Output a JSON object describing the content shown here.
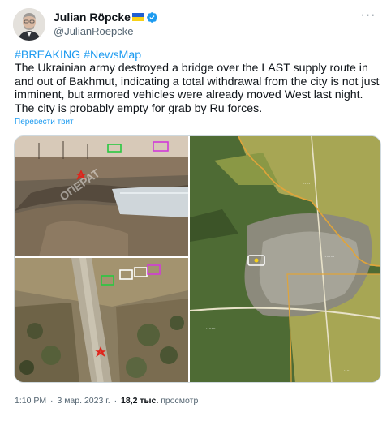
{
  "author": {
    "display_name": "Julian Röpcke",
    "handle": "@JulianRoepcke",
    "flag_icon": "ukraine-flag-icon",
    "verified_icon": "verified-badge-icon"
  },
  "more_icon": "more-options-icon",
  "tweet": {
    "hashtag_breaking": "#BREAKING",
    "hashtag_newsmap": "#NewsMap",
    "body": "The Ukrainian army destroyed a bridge over the LAST supply route in and out of Bakhmut, indicating a total withdrawal from the city is not just imminent, but armored vehicles were already moved West last night. The city is probably empty for grab by Ru forces.",
    "translate_link": "Перевести твит"
  },
  "meta": {
    "time": "1:10 PM",
    "date": "3 мар. 2023 г.",
    "views_count": "18,2 тыс.",
    "views_label": "просмотр"
  },
  "colors": {
    "link": "#1d9bf0",
    "text": "#0f1419",
    "secondary": "#536471",
    "border": "#cfd9de"
  }
}
